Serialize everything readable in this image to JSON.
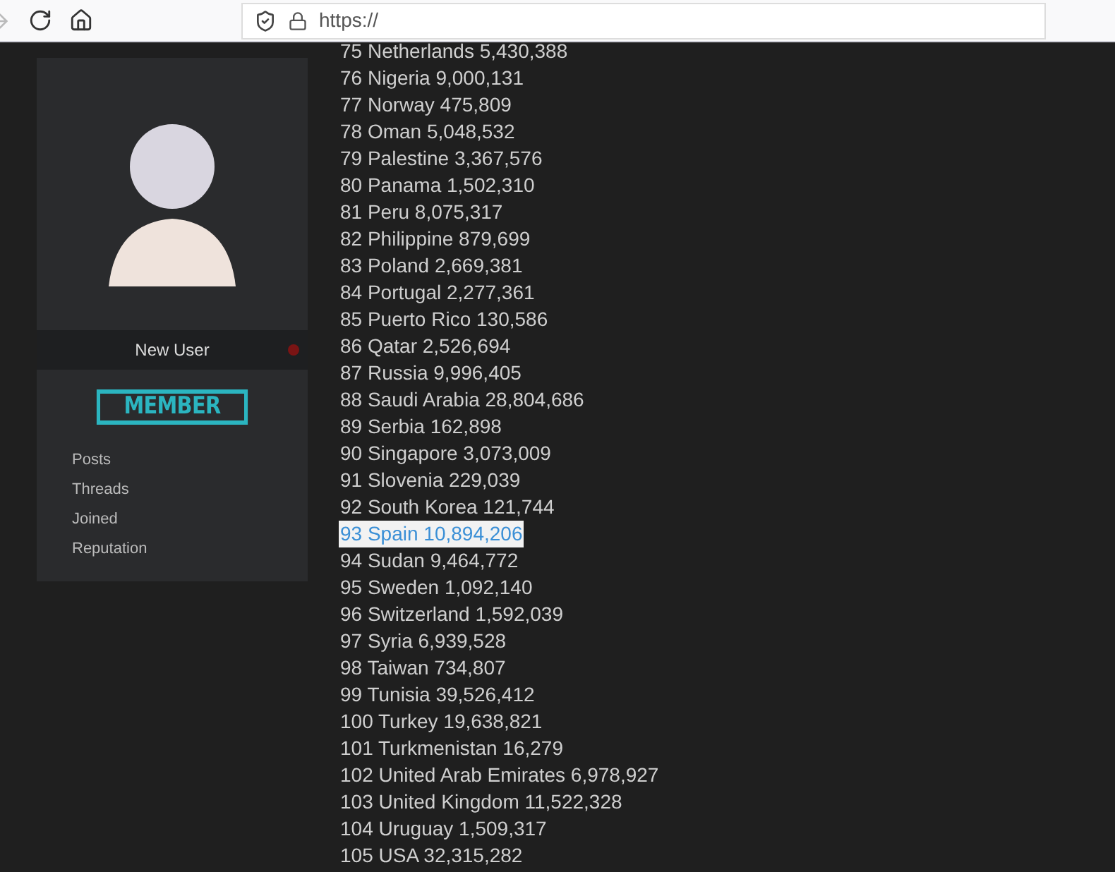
{
  "browser": {
    "address": "https://"
  },
  "profile": {
    "rank": "New User",
    "online": false,
    "badge": "MEMBER",
    "stats": [
      {
        "label": "Posts"
      },
      {
        "label": "Threads"
      },
      {
        "label": "Joined"
      },
      {
        "label": "Reputation"
      }
    ]
  },
  "list": [
    {
      "text": "75 Netherlands 5,430,388",
      "selected": false
    },
    {
      "text": "76 Nigeria 9,000,131",
      "selected": false
    },
    {
      "text": "77 Norway 475,809",
      "selected": false
    },
    {
      "text": "78 Oman 5,048,532",
      "selected": false
    },
    {
      "text": "79 Palestine 3,367,576",
      "selected": false
    },
    {
      "text": "80 Panama 1,502,310",
      "selected": false
    },
    {
      "text": "81 Peru 8,075,317",
      "selected": false
    },
    {
      "text": "82 Philippine 879,699",
      "selected": false
    },
    {
      "text": "83 Poland 2,669,381",
      "selected": false
    },
    {
      "text": "84 Portugal 2,277,361",
      "selected": false
    },
    {
      "text": "85 Puerto Rico 130,586",
      "selected": false
    },
    {
      "text": "86 Qatar 2,526,694",
      "selected": false
    },
    {
      "text": "87 Russia 9,996,405",
      "selected": false
    },
    {
      "text": "88 Saudi Arabia 28,804,686",
      "selected": false
    },
    {
      "text": "89 Serbia 162,898",
      "selected": false
    },
    {
      "text": "90 Singapore 3,073,009",
      "selected": false
    },
    {
      "text": "91 Slovenia 229,039",
      "selected": false
    },
    {
      "text": "92 South Korea 121,744",
      "selected": false
    },
    {
      "text": "93 Spain 10,894,206",
      "selected": true
    },
    {
      "text": "94 Sudan 9,464,772",
      "selected": false
    },
    {
      "text": "95 Sweden 1,092,140",
      "selected": false
    },
    {
      "text": "96 Switzerland 1,592,039",
      "selected": false
    },
    {
      "text": "97 Syria 6,939,528",
      "selected": false
    },
    {
      "text": "98 Taiwan 734,807",
      "selected": false
    },
    {
      "text": "99 Tunisia 39,526,412",
      "selected": false
    },
    {
      "text": "100 Turkey 19,638,821",
      "selected": false
    },
    {
      "text": "101 Turkmenistan 16,279",
      "selected": false
    },
    {
      "text": "102 United Arab Emirates 6,978,927",
      "selected": false
    },
    {
      "text": "103 United Kingdom 11,522,328",
      "selected": false
    },
    {
      "text": "104 Uruguay 1,509,317",
      "selected": false
    },
    {
      "text": "105 USA 32,315,282",
      "selected": false
    }
  ]
}
